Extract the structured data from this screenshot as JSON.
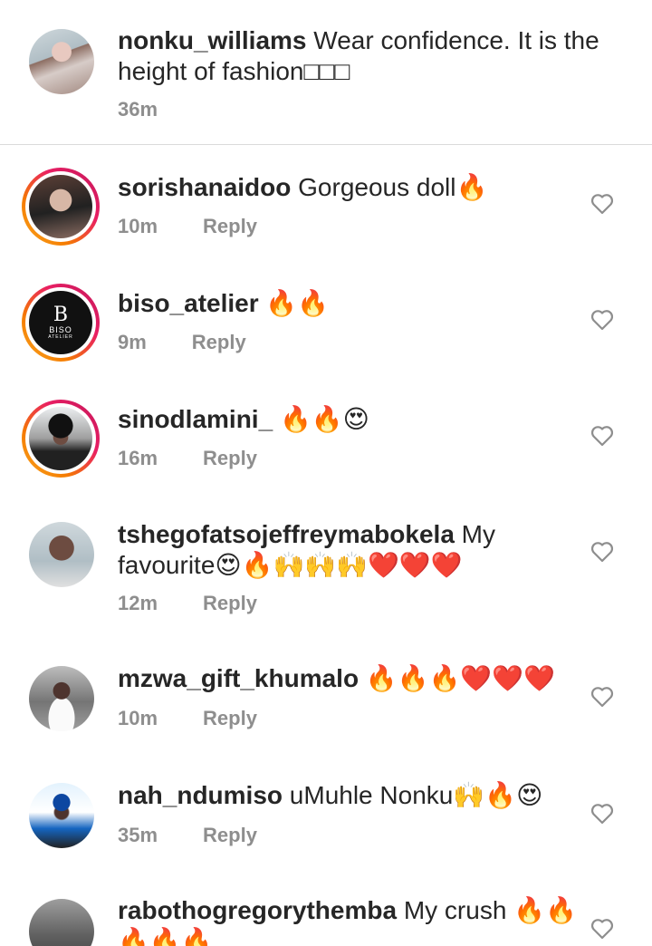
{
  "caption": {
    "username": "nonku_williams",
    "text": "Wear confidence. It is the height of fashion□□□",
    "time": "36m"
  },
  "reply_label": "Reply",
  "icons": {
    "like": "heart-outline-icon"
  },
  "colors": {
    "story_ring_start": "#f9a825",
    "story_ring_end": "#c2185b",
    "meta_text": "#8e8e8e"
  },
  "comments": [
    {
      "username": "sorishanaidoo",
      "text": "Gorgeous doll🔥",
      "time": "10m",
      "story_ring": true
    },
    {
      "username": "biso_atelier",
      "text": "🔥🔥",
      "time": "9m",
      "story_ring": true,
      "avatar_text": {
        "mark": "B",
        "name": "BISO",
        "sub": "ATELIER"
      }
    },
    {
      "username": "sinodlamini_",
      "text": "🔥🔥😍",
      "time": "16m",
      "story_ring": true
    },
    {
      "username": "tshegofatsojeffreymabokela",
      "text": "My favourite😍🔥🙌🙌🙌❤️❤️❤️",
      "time": "12m",
      "story_ring": false
    },
    {
      "username": "mzwa_gift_khumalo",
      "text": "🔥🔥🔥❤️❤️❤️",
      "time": "10m",
      "story_ring": false
    },
    {
      "username": "nah_ndumiso",
      "text": "uMuhle  Nonku🙌🔥😍",
      "time": "35m",
      "story_ring": false
    },
    {
      "username": "rabothogregorythemba",
      "text": "My crush 🔥🔥 🔥🔥🔥",
      "time": "",
      "story_ring": false
    }
  ]
}
